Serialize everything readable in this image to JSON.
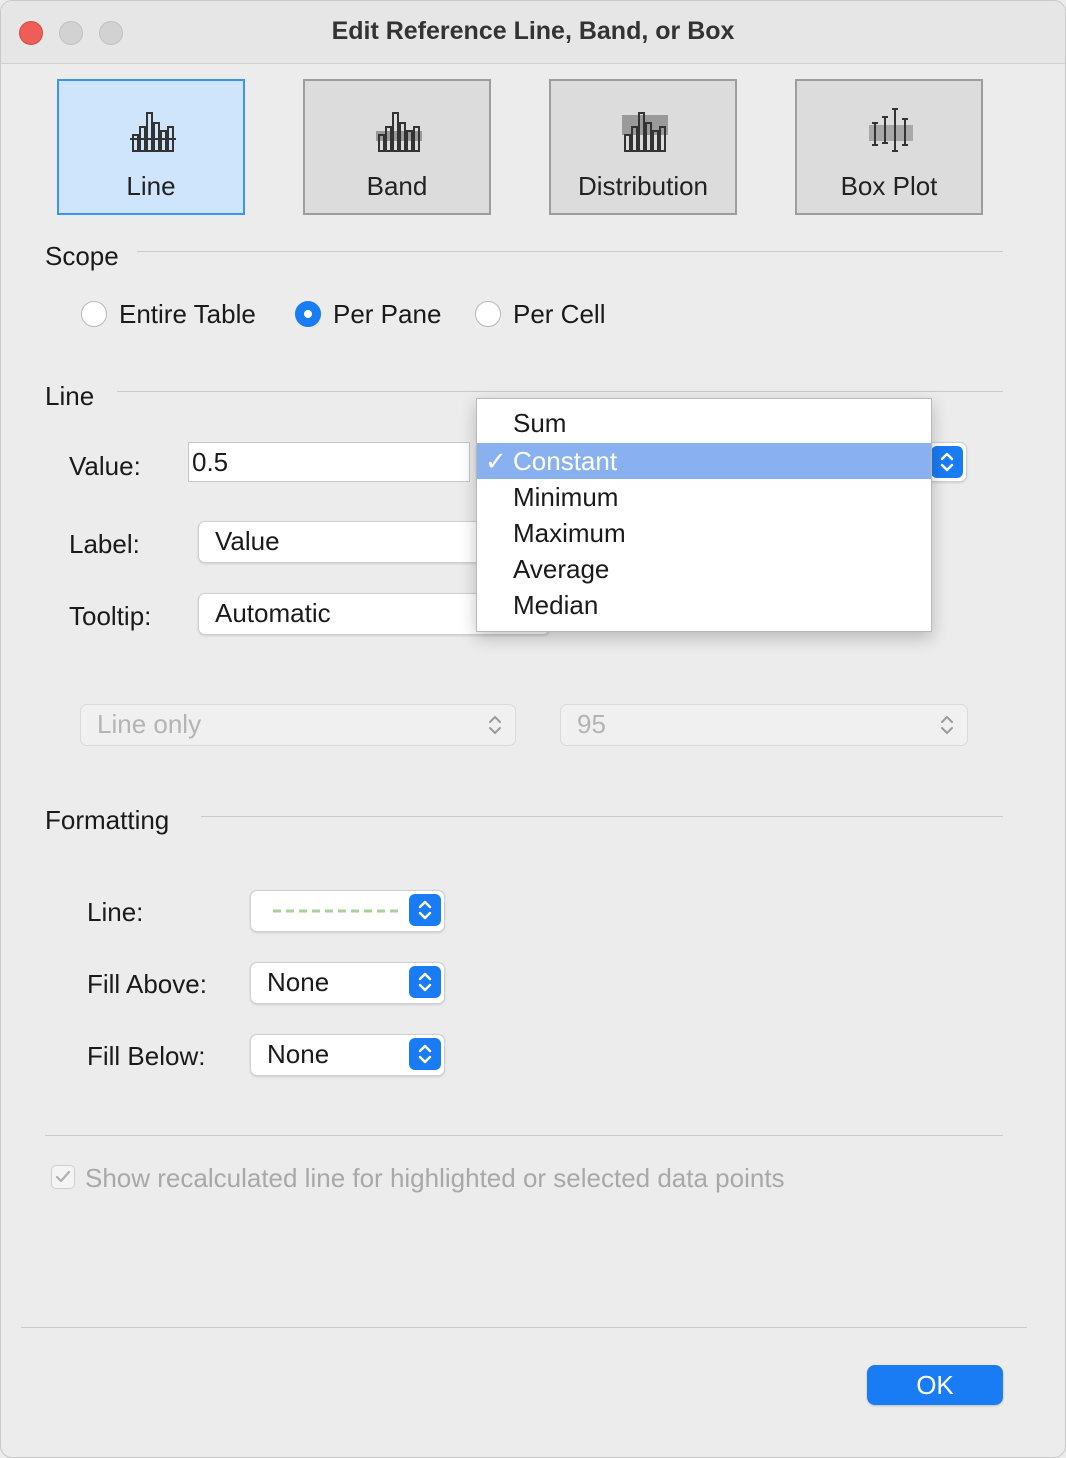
{
  "window": {
    "title": "Edit Reference Line, Band, or Box"
  },
  "type_buttons": [
    {
      "label": "Line",
      "active": true
    },
    {
      "label": "Band",
      "active": false
    },
    {
      "label": "Distribution",
      "active": false
    },
    {
      "label": "Box Plot",
      "active": false
    }
  ],
  "scope": {
    "heading": "Scope",
    "options": [
      {
        "label": "Entire Table",
        "selected": false
      },
      {
        "label": "Per Pane",
        "selected": true
      },
      {
        "label": "Per Cell",
        "selected": false
      }
    ]
  },
  "line": {
    "heading": "Line",
    "value_label": "Value:",
    "value": "0.5",
    "label_label": "Label:",
    "label_value": "Value",
    "tooltip_label": "Tooltip:",
    "tooltip_value": "Automatic",
    "aggregation_menu": {
      "items": [
        "Sum",
        "Constant",
        "Minimum",
        "Maximum",
        "Average",
        "Median"
      ],
      "selected": "Constant",
      "check": "✓"
    },
    "confidence_display": "Line only",
    "confidence_level": "95"
  },
  "formatting": {
    "heading": "Formatting",
    "line_label": "Line:",
    "line_style_color": "#a8cf9c",
    "fill_above_label": "Fill Above:",
    "fill_above_value": "None",
    "fill_below_label": "Fill Below:",
    "fill_below_value": "None"
  },
  "recalc_checkbox": {
    "label": "Show recalculated line for highlighted or selected data points",
    "checked": true,
    "enabled": false
  },
  "ok_label": "OK",
  "colors": {
    "accent": "#1a7cf5",
    "selection": "#8ab1ef",
    "active_tab": "#cfe5fb"
  }
}
